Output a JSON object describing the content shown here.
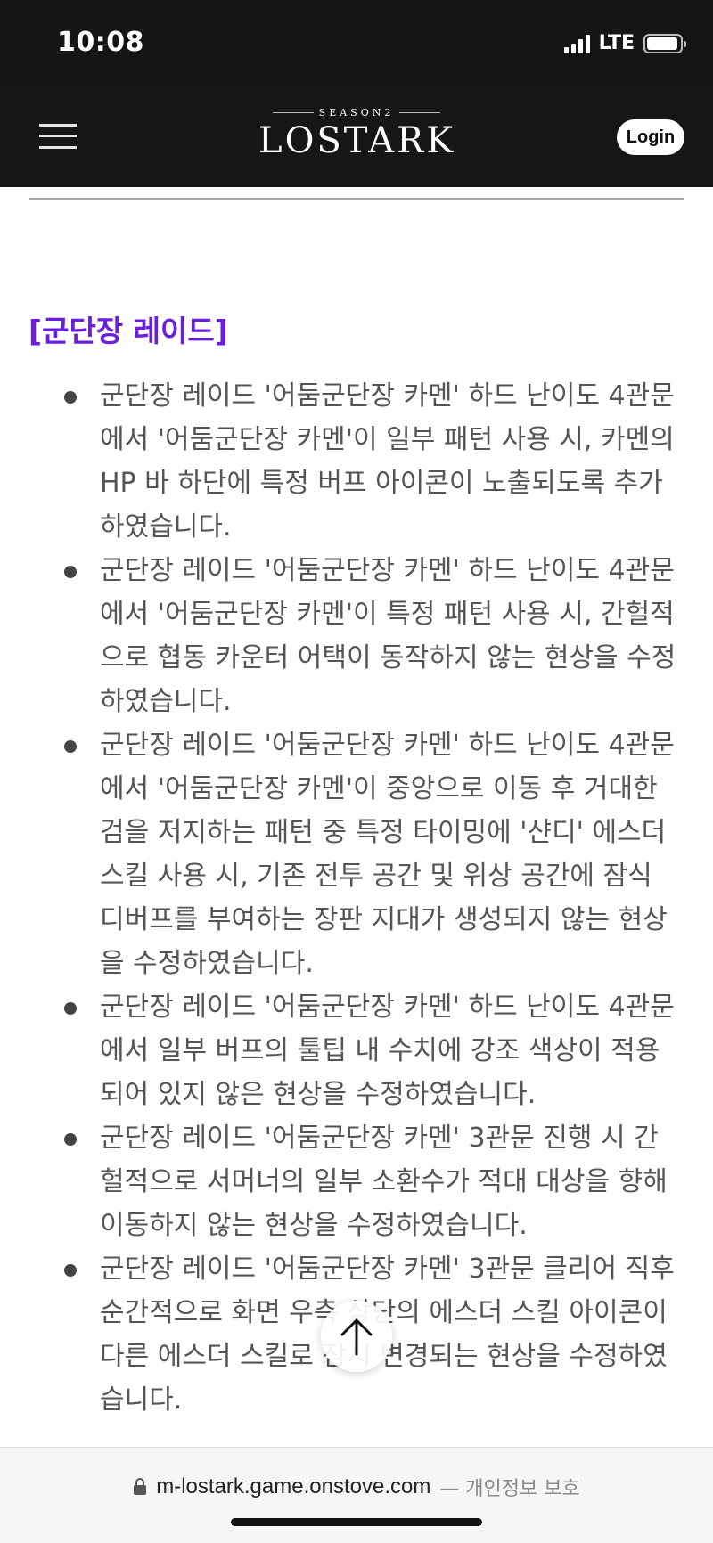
{
  "status": {
    "time": "10:08",
    "network": "LTE"
  },
  "header": {
    "logo_season": "SEASON2",
    "logo_main": "LOSTARK",
    "login_label": "Login"
  },
  "section": {
    "title": "[군단장 레이드]"
  },
  "items": [
    {
      "text": "군단장 레이드 '어둠군단장 카멘' 하드 난이도 4관문에서 '어둠군단장 카멘'이 일부 패턴 사용 시, 카멘의 HP 바 하단에 특정 버프 아이콘이 노출되도록 추가하였습니다."
    },
    {
      "text": "군단장 레이드 '어둠군단장 카멘' 하드 난이도 4관문에서 '어둠군단장 카멘'이 특정 패턴 사용 시, 간헐적으로 협동 카운터 어택이 동작하지 않는 현상을 수정하였습니다."
    },
    {
      "text": "군단장 레이드 '어둠군단장 카멘' 하드 난이도 4관문에서 '어둠군단장 카멘'이 중앙으로 이동 후 거대한 검을 저지하는 패턴 중 특정 타이밍에 '샨디' 에스더 스킬 사용 시, 기존 전투 공간 및 위상 공간에 잠식 디버프를 부여하는 장판 지대가 생성되지 않는 현상을 수정하였습니다."
    },
    {
      "text": "군단장 레이드 '어둠군단장 카멘' 하드 난이도 4관문에서 일부 버프의 툴팁 내 수치에 강조 색상이 적용되어 있지 않은 현상을 수정하였습니다."
    },
    {
      "text": "군단장 레이드 '어둠군단장 카멘' 3관문 진행 시 간헐적으로 서머너의 일부 소환수가 적대 대상을 향해 이동하지 않는 현상을 수정하였습니다."
    },
    {
      "text": "군단장 레이드 '어둠군단장 카멘' 3관문 클리어 직후 순간적으로 화면 우측 상단의 에스더 스킬 아이콘이 다른 에스더 스킬로 잠시 변경되는 현상을 수정하였습니다."
    }
  ],
  "browser": {
    "url": "m-lostark.game.onstove.com",
    "suffix": "— 개인정보 보호"
  },
  "icons": {
    "menu": "hamburger-icon",
    "scroll": "arrow-up-icon",
    "lock": "lock-icon"
  },
  "colors": {
    "accent": "#6a1ee0",
    "header_bg": "#161616"
  }
}
